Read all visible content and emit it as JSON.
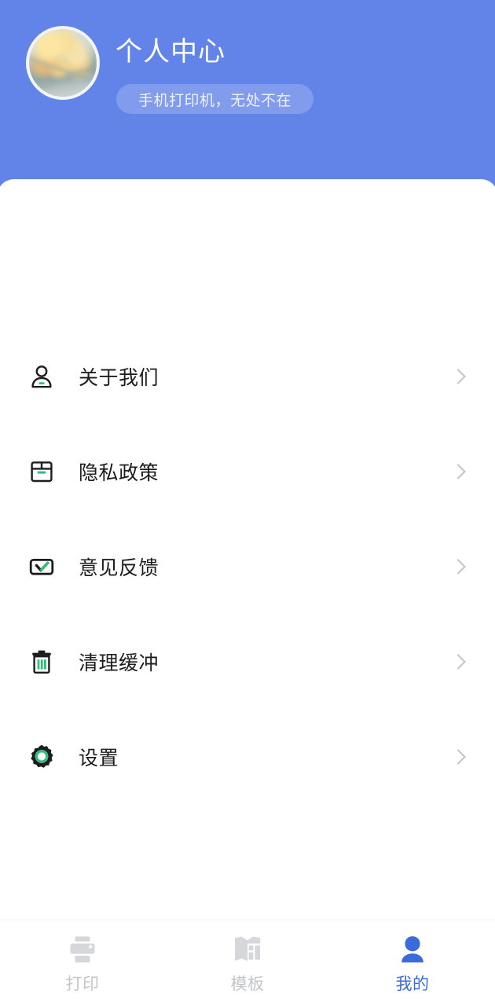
{
  "header": {
    "title": "个人中心",
    "tagline": "手机打印机，无处不在",
    "avatar_icon": "avatar-photo",
    "background_color": "#6284e8",
    "title_color": "#ffffff"
  },
  "menu": {
    "items": [
      {
        "label": "关于我们",
        "icon": "person-icon",
        "chevron": "chevron-right-icon"
      },
      {
        "label": "隐私政策",
        "icon": "package-icon",
        "chevron": "chevron-right-icon"
      },
      {
        "label": "意见反馈",
        "icon": "feedback-check-icon",
        "chevron": "chevron-right-icon"
      },
      {
        "label": "清理缓冲",
        "icon": "trash-icon",
        "chevron": "chevron-right-icon"
      },
      {
        "label": "设置",
        "icon": "gear-icon",
        "chevron": "chevron-right-icon"
      }
    ],
    "icon_accent_color": "#2ec07a",
    "icon_stroke_color": "#1d1d1f",
    "label_color": "#1d1d1f",
    "chevron_color": "#b9b9bd"
  },
  "tabbar": {
    "tabs": [
      {
        "label": "打印",
        "icon": "printer-icon",
        "active": false
      },
      {
        "label": "模板",
        "icon": "template-icon",
        "active": false
      },
      {
        "label": "我的",
        "icon": "person-filled-icon",
        "active": true
      }
    ],
    "active_color": "#3a6bdb",
    "inactive_color": "#c3c5c9"
  }
}
